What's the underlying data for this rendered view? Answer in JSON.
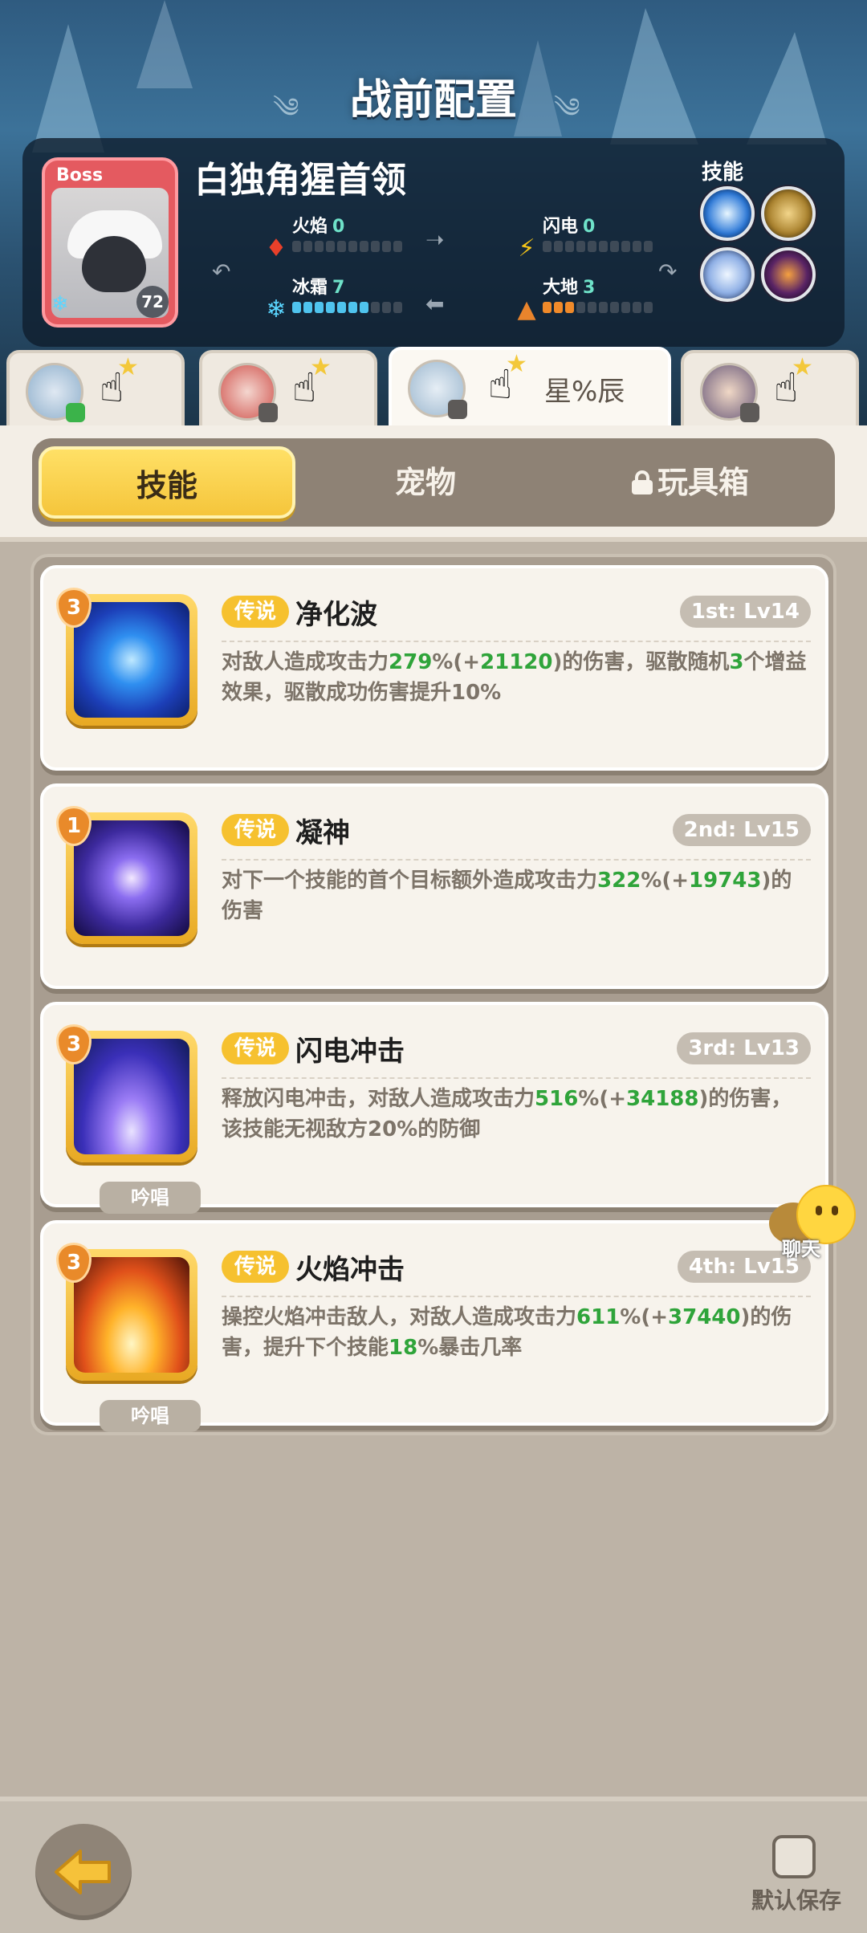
{
  "header": {
    "title": "战前配置"
  },
  "boss": {
    "tag": "Boss",
    "name": "白独角猩首领",
    "level": "72",
    "stats": [
      {
        "key": "fire",
        "label": "火焰",
        "value": "0"
      },
      {
        "key": "lightning",
        "label": "闪电",
        "value": "0"
      },
      {
        "key": "frost",
        "label": "冰霜",
        "value": "7"
      },
      {
        "key": "earth",
        "label": "大地",
        "value": "3"
      }
    ],
    "skills_label": "技能"
  },
  "hero_tabs": [
    {
      "name": "",
      "active": false
    },
    {
      "name": "",
      "active": false
    },
    {
      "name": "星%辰",
      "active": true
    },
    {
      "name": "",
      "active": false
    }
  ],
  "tabs": {
    "skills": "技能",
    "pets": "宠物",
    "toybox": "玩具箱"
  },
  "skills": [
    {
      "level_badge": "3",
      "rarity": "传说",
      "name": "净化波",
      "order": "1st: Lv14",
      "chant": "",
      "desc": [
        {
          "t": "对敌人造成攻击力"
        },
        {
          "t": "279",
          "g": true
        },
        {
          "t": "%(+"
        },
        {
          "t": "21120",
          "g": true
        },
        {
          "t": ")的伤害，驱散随机"
        },
        {
          "t": "3",
          "g": true
        },
        {
          "t": "个增益效果，驱散成功伤害提升10%"
        }
      ]
    },
    {
      "level_badge": "1",
      "rarity": "传说",
      "name": "凝神",
      "order": "2nd: Lv15",
      "chant": "",
      "desc": [
        {
          "t": "对下一个技能的首个目标额外造成攻击力"
        },
        {
          "t": "322",
          "g": true
        },
        {
          "t": "%(+"
        },
        {
          "t": "19743",
          "g": true
        },
        {
          "t": ")的伤害"
        }
      ]
    },
    {
      "level_badge": "3",
      "rarity": "传说",
      "name": "闪电冲击",
      "order": "3rd: Lv13",
      "chant": "吟唱",
      "desc": [
        {
          "t": "释放闪电冲击，对敌人造成攻击力"
        },
        {
          "t": "516",
          "g": true
        },
        {
          "t": "%(+"
        },
        {
          "t": "34188",
          "g": true
        },
        {
          "t": ")的伤害，该技能无视敌方20%的防御"
        }
      ]
    },
    {
      "level_badge": "3",
      "rarity": "传说",
      "name": "火焰冲击",
      "order": "4th: Lv15",
      "chant": "吟唱",
      "desc": [
        {
          "t": "操控火焰冲击敌人，对敌人造成攻击力"
        },
        {
          "t": "611",
          "g": true
        },
        {
          "t": "%(+"
        },
        {
          "t": "37440",
          "g": true
        },
        {
          "t": ")的伤害，提升下个技能"
        },
        {
          "t": "18",
          "g": true
        },
        {
          "t": "%暴击几率"
        }
      ]
    }
  ],
  "chat": {
    "label": "聊天"
  },
  "footer": {
    "save_label": "默认保存"
  },
  "colors": {
    "accent_yellow": "#f6c12f",
    "highlight_green": "#2fa43a",
    "boss_red": "#e45a60"
  }
}
